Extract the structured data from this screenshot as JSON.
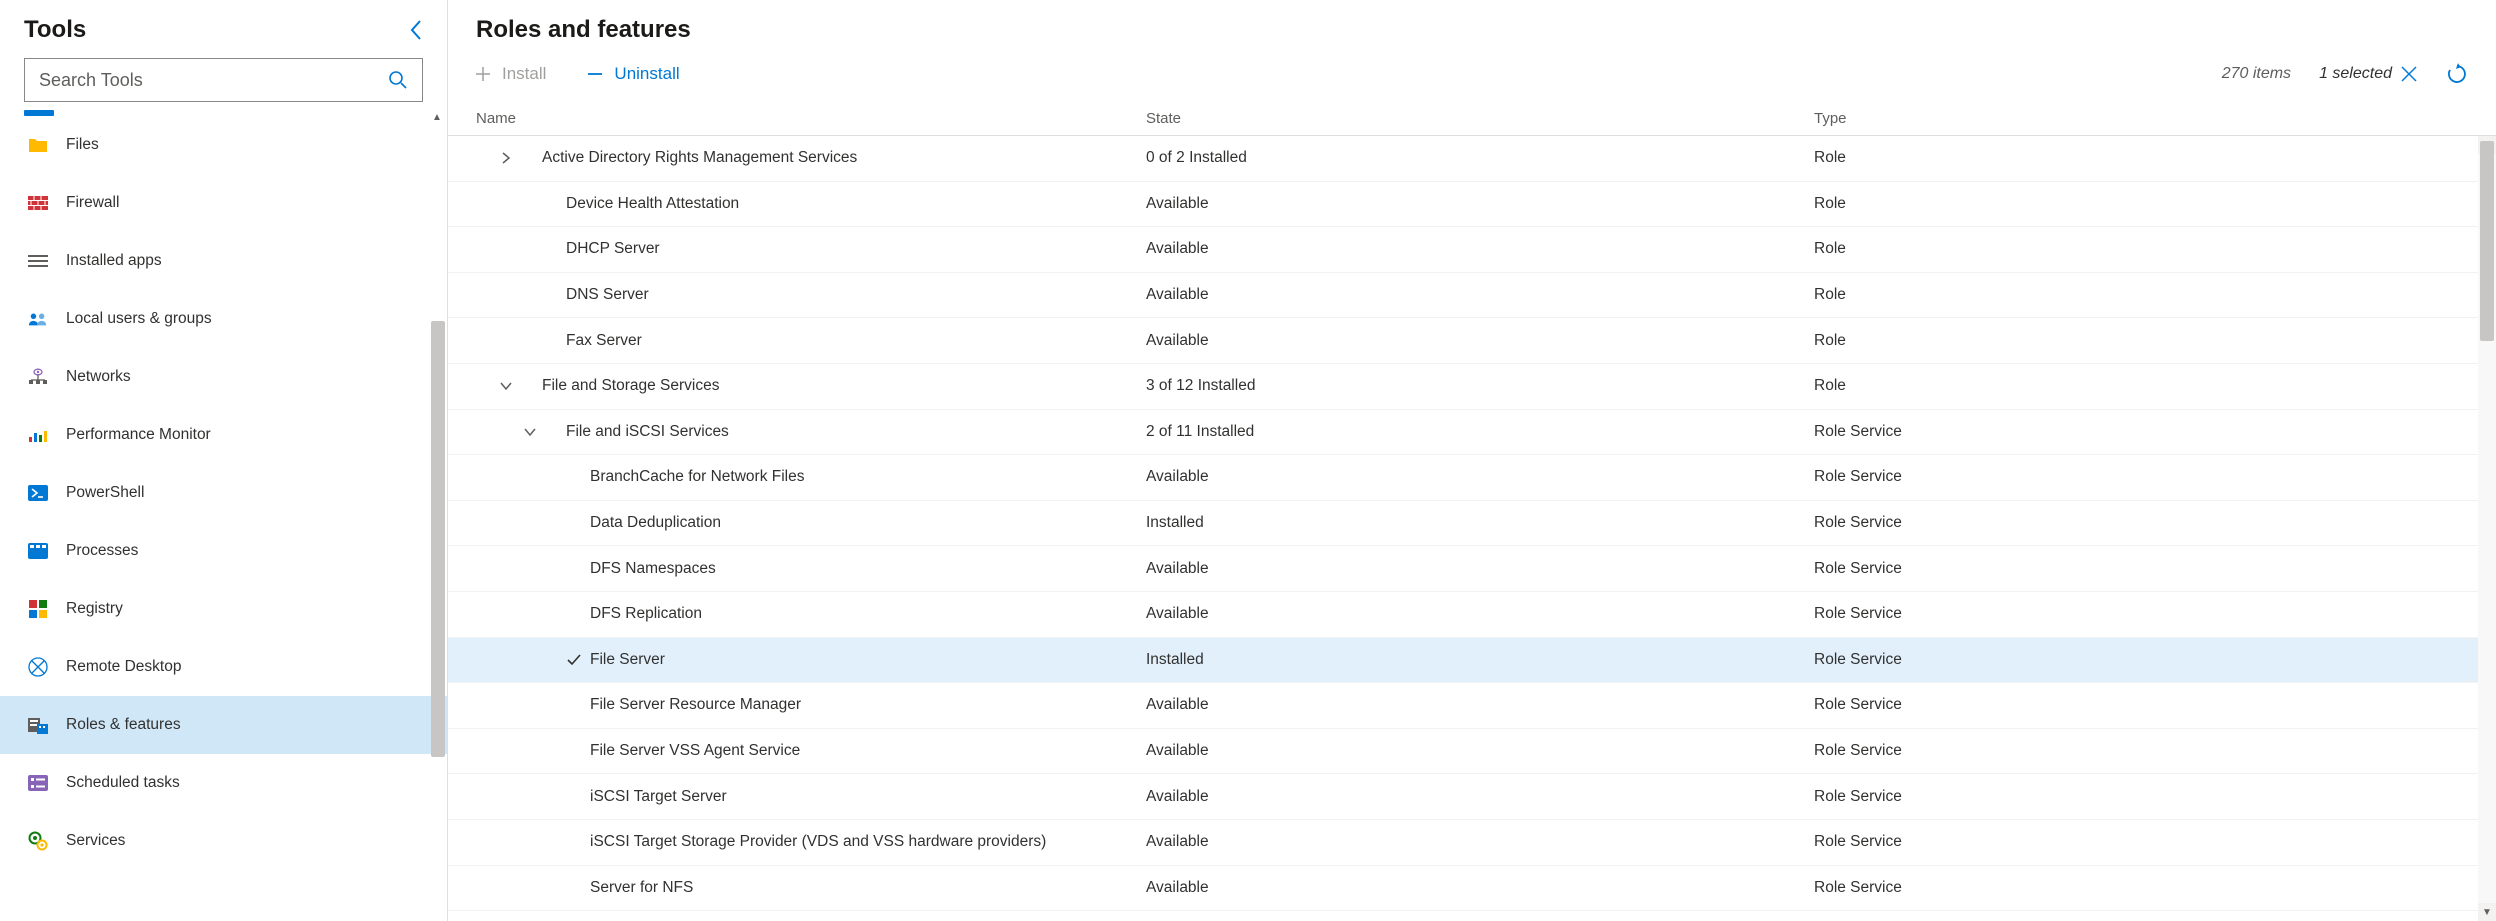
{
  "sidebar": {
    "title": "Tools",
    "search_placeholder": "Search Tools",
    "items": [
      {
        "label": "Files",
        "icon": "folder",
        "color": "#ffb900"
      },
      {
        "label": "Firewall",
        "icon": "firewall",
        "color": "#d13438"
      },
      {
        "label": "Installed apps",
        "icon": "apps",
        "color": "#605e5c"
      },
      {
        "label": "Local users & groups",
        "icon": "users",
        "color": "#0078d4"
      },
      {
        "label": "Networks",
        "icon": "network",
        "color": "#8764b8"
      },
      {
        "label": "Performance Monitor",
        "icon": "perfmon",
        "color": "#0078d4"
      },
      {
        "label": "PowerShell",
        "icon": "powershell",
        "color": "#0078d4"
      },
      {
        "label": "Processes",
        "icon": "processes",
        "color": "#0078d4"
      },
      {
        "label": "Registry",
        "icon": "registry",
        "color": "#107c10"
      },
      {
        "label": "Remote Desktop",
        "icon": "remote",
        "color": "#0078d4"
      },
      {
        "label": "Roles & features",
        "icon": "roles",
        "color": "#0078d4",
        "selected": true
      },
      {
        "label": "Scheduled tasks",
        "icon": "tasks",
        "color": "#8764b8"
      },
      {
        "label": "Services",
        "icon": "services",
        "color": "#107c10"
      }
    ]
  },
  "main": {
    "title": "Roles and features",
    "install_label": "Install",
    "uninstall_label": "Uninstall",
    "items_count": "270 items",
    "selected_count": "1 selected",
    "columns": {
      "name": "Name",
      "state": "State",
      "type": "Type"
    },
    "rows": [
      {
        "indent": 1,
        "expander": "right",
        "name": "Active Directory Rights Management Services",
        "state": "0 of 2 Installed",
        "type": "Role"
      },
      {
        "indent": 2,
        "name": "Device Health Attestation",
        "state": "Available",
        "type": "Role"
      },
      {
        "indent": 2,
        "name": "DHCP Server",
        "state": "Available",
        "type": "Role"
      },
      {
        "indent": 2,
        "name": "DNS Server",
        "state": "Available",
        "type": "Role"
      },
      {
        "indent": 2,
        "name": "Fax Server",
        "state": "Available",
        "type": "Role"
      },
      {
        "indent": 1,
        "expander": "down",
        "name": "File and Storage Services",
        "state": "3 of 12 Installed",
        "type": "Role"
      },
      {
        "indent": 2,
        "expander": "down",
        "name": "File and iSCSI Services",
        "state": "2 of 11 Installed",
        "type": "Role Service"
      },
      {
        "indent": 3,
        "name": "BranchCache for Network Files",
        "state": "Available",
        "type": "Role Service"
      },
      {
        "indent": 3,
        "name": "Data Deduplication",
        "state": "Installed",
        "type": "Role Service"
      },
      {
        "indent": 3,
        "name": "DFS Namespaces",
        "state": "Available",
        "type": "Role Service"
      },
      {
        "indent": 3,
        "name": "DFS Replication",
        "state": "Available",
        "type": "Role Service"
      },
      {
        "indent": 3,
        "name": "File Server",
        "state": "Installed",
        "type": "Role Service",
        "selected": true,
        "checked": true
      },
      {
        "indent": 3,
        "name": "File Server Resource Manager",
        "state": "Available",
        "type": "Role Service"
      },
      {
        "indent": 3,
        "name": "File Server VSS Agent Service",
        "state": "Available",
        "type": "Role Service"
      },
      {
        "indent": 3,
        "name": "iSCSI Target Server",
        "state": "Available",
        "type": "Role Service"
      },
      {
        "indent": 3,
        "name": "iSCSI Target Storage Provider (VDS and VSS hardware providers)",
        "state": "Available",
        "type": "Role Service"
      },
      {
        "indent": 3,
        "name": "Server for NFS",
        "state": "Available",
        "type": "Role Service"
      }
    ]
  }
}
